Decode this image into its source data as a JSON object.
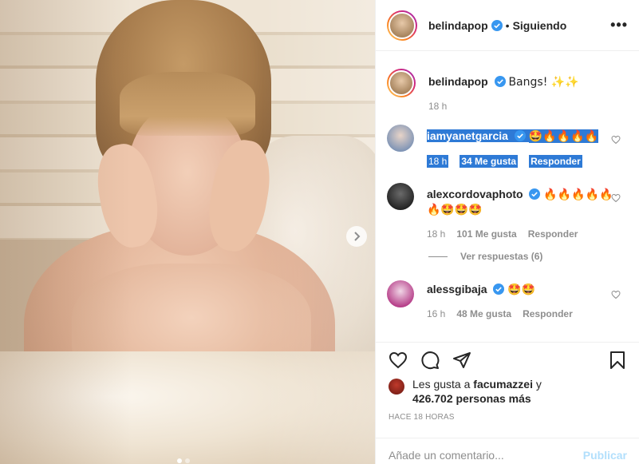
{
  "post": {
    "author": "belindapop",
    "header_separator": "•",
    "follow_status": "Siguiendo",
    "more_label": "•••",
    "caption": "Bangs! ✨✨",
    "caption_time": "18 h"
  },
  "comments": [
    {
      "user": "iamyanetgarcia",
      "text": "🤩🔥🔥🔥🔥",
      "time": "18 h",
      "likes": "34 Me gusta",
      "reply": "Responder",
      "selected": true
    },
    {
      "user": "alexcordovaphoto",
      "text_line1": "🔥🔥🔥🔥🔥",
      "text_line2": "🔥🤩🤩🤩",
      "time": "18 h",
      "likes": "101 Me gusta",
      "reply": "Responder",
      "view_replies": "Ver respuestas (6)"
    },
    {
      "user": "alessgibaja",
      "text": "🤩🤩",
      "time": "16 h",
      "likes": "48 Me gusta",
      "reply": "Responder"
    }
  ],
  "likes": {
    "prefix": "Les gusta a",
    "user": "facumazzei",
    "connector": "y",
    "count": "426.702 personas más"
  },
  "timestamp": "HACE 18 HORAS",
  "comment_input": {
    "placeholder": "Añade un comentario...",
    "publish": "Publicar"
  },
  "colors": {
    "selection": "#2e7ad6",
    "verified": "#3897f0",
    "publish": "#b2dffc",
    "muted": "#8e8e8e"
  }
}
